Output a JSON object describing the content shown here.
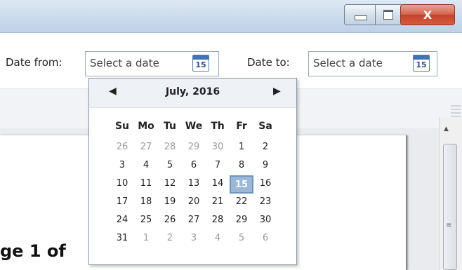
{
  "window": {
    "minimize_icon": "minimize-icon",
    "maximize_icon": "maximize-icon",
    "close_label": "X"
  },
  "filters": {
    "date_from_label": "Date from:",
    "date_from_placeholder": "Select a date",
    "date_to_label": "Date to:",
    "date_to_placeholder": "Select a date",
    "calendar_icon_number": "15"
  },
  "calendar": {
    "month_label": "July, 2016",
    "prev_icon": "◀",
    "next_icon": "▶",
    "weekdays": [
      "Su",
      "Mo",
      "Tu",
      "We",
      "Th",
      "Fr",
      "Sa"
    ],
    "days": [
      {
        "d": "26",
        "other": true
      },
      {
        "d": "27",
        "other": true
      },
      {
        "d": "28",
        "other": true
      },
      {
        "d": "29",
        "other": true
      },
      {
        "d": "30",
        "other": true
      },
      {
        "d": "1",
        "other": false
      },
      {
        "d": "2",
        "other": false
      },
      {
        "d": "3",
        "other": false
      },
      {
        "d": "4",
        "other": false
      },
      {
        "d": "5",
        "other": false
      },
      {
        "d": "6",
        "other": false
      },
      {
        "d": "7",
        "other": false
      },
      {
        "d": "8",
        "other": false
      },
      {
        "d": "9",
        "other": false
      },
      {
        "d": "10",
        "other": false
      },
      {
        "d": "11",
        "other": false
      },
      {
        "d": "12",
        "other": false
      },
      {
        "d": "13",
        "other": false
      },
      {
        "d": "14",
        "other": false
      },
      {
        "d": "15",
        "other": false,
        "selected": true
      },
      {
        "d": "16",
        "other": false
      },
      {
        "d": "17",
        "other": false
      },
      {
        "d": "18",
        "other": false
      },
      {
        "d": "19",
        "other": false
      },
      {
        "d": "20",
        "other": false
      },
      {
        "d": "21",
        "other": false
      },
      {
        "d": "22",
        "other": false
      },
      {
        "d": "23",
        "other": false
      },
      {
        "d": "24",
        "other": false
      },
      {
        "d": "25",
        "other": false
      },
      {
        "d": "26",
        "other": false
      },
      {
        "d": "27",
        "other": false
      },
      {
        "d": "28",
        "other": false
      },
      {
        "d": "29",
        "other": false
      },
      {
        "d": "30",
        "other": false
      },
      {
        "d": "31",
        "other": false
      },
      {
        "d": "1",
        "other": true
      },
      {
        "d": "2",
        "other": true
      },
      {
        "d": "3",
        "other": true
      },
      {
        "d": "4",
        "other": true
      },
      {
        "d": "5",
        "other": true
      },
      {
        "d": "6",
        "other": true
      }
    ]
  },
  "document": {
    "page_text": "ge 1 of"
  },
  "colors": {
    "selected_day": "#9bb9d6",
    "close_button": "#c4412a"
  }
}
